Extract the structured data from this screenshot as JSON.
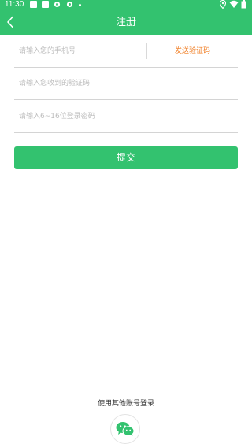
{
  "status_bar": {
    "time": "11:30",
    "icons": [
      "notification-square-icon",
      "notification-square-icon",
      "settings-gear-icon",
      "settings-gear-icon",
      "dot-icon",
      "location-icon",
      "wifi-icon",
      "battery-icon"
    ]
  },
  "header": {
    "title": "注册",
    "back_icon": "chevron-left-icon"
  },
  "form": {
    "phone_placeholder": "请输入您的手机号",
    "phone_value": "",
    "send_code_label": "发送验证码",
    "code_placeholder": "请输入您收到的验证码",
    "code_value": "",
    "password_placeholder": "请输入6~16位登录密码",
    "password_value": "",
    "submit_label": "提交"
  },
  "other_login": {
    "label": "使用其他账号登录",
    "providers": [
      {
        "name": "wechat",
        "icon": "wechat-icon"
      }
    ]
  },
  "colors": {
    "primary": "#33c26f",
    "accent": "#f07a1d",
    "divider": "#d4d4d4",
    "placeholder": "#bdbdbd"
  }
}
